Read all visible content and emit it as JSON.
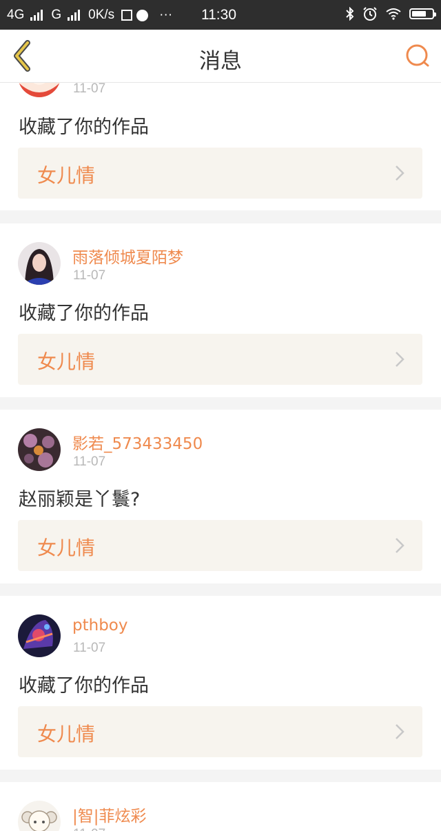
{
  "status_bar": {
    "network1": "4G",
    "network2": "G",
    "speed": "0K/s",
    "time": "11:30",
    "more": "···"
  },
  "header": {
    "title": "消息"
  },
  "notifications": [
    {
      "username": "",
      "date": "11-07",
      "message": "收藏了你的作品",
      "work_title": "女儿情"
    },
    {
      "username": "雨落倾城夏陌梦",
      "date": "11-07",
      "message": "收藏了你的作品",
      "work_title": "女儿情"
    },
    {
      "username": "影若_573433450",
      "date": "11-07",
      "message": "赵丽颖是丫鬟?",
      "work_title": "女儿情"
    },
    {
      "username": "pthboy",
      "date": "11-07",
      "message": "收藏了你的作品",
      "work_title": "女儿情"
    },
    {
      "username": "|智|菲炫彩",
      "date": "11-07",
      "message": "",
      "work_title": ""
    }
  ],
  "colors": {
    "accent": "#ef8a4e",
    "back_icon": "#e6c64a",
    "card_bg": "#f7f4ee"
  }
}
